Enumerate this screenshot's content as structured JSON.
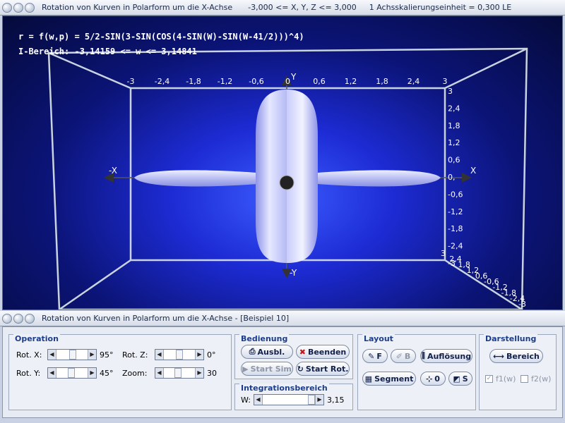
{
  "window": {
    "title": "Rotation von Kurven in Polarform um die X-Achse",
    "range": "-3,000 <= X, Y, Z <= 3,000",
    "scale": "1 Achsskalierungseinheit = 0,300 LE"
  },
  "scene": {
    "formula": "r = f(w,p) = 5/2-SIN(3-SIN(COS(4-SIN(W)-SIN(W-41/2)))^4)",
    "interval": "I-Bereich: -3,14159 <= w <= 3,14841",
    "x_ticks": [
      "-3",
      "-2,4",
      "-1,8",
      "-1,2",
      "-0,6",
      "0",
      "0,6",
      "1,2",
      "1,8",
      "2,4",
      "3"
    ],
    "y_ticks": [
      "3",
      "2,4",
      "1,8",
      "1,2",
      "0,6",
      "0,",
      "-0,6",
      "-1,2",
      "-1,8",
      "-2,4",
      "-3"
    ],
    "z_ticks": [
      "3",
      "2,4",
      "1,8",
      "1,2",
      "0,6",
      "-0,6",
      "-1,2",
      "-1,8",
      "-2,4",
      "-3"
    ],
    "axis_labels": {
      "x": "X",
      "neg_x": "-X",
      "y": "Y",
      "neg_y": "-Y"
    },
    "colors": {
      "bg_center": "#3b5cff",
      "bg_edge": "#050a3a",
      "surface": "#c9ccff"
    }
  },
  "panel": {
    "title": "Rotation von Kurven in Polarform um die X-Achse - [Beispiel 10]"
  },
  "operation": {
    "label": "Operation",
    "rot_x_label": "Rot. X:",
    "rot_x_value": "95°",
    "rot_y_label": "Rot. Y:",
    "rot_y_value": "45°",
    "rot_z_label": "Rot. Z:",
    "rot_z_value": "0°",
    "zoom_label": "Zoom:",
    "zoom_value": "30"
  },
  "bedienung": {
    "label": "Bedienung",
    "ausbl": "Ausbl.",
    "beenden": "Beenden",
    "start_sim": "Start Sim",
    "start_rot": "Start Rot."
  },
  "integration": {
    "label": "Integrationsbereich",
    "w_label": "W:",
    "w_value": "3,15"
  },
  "layout": {
    "label": "Layout",
    "f_btn": "F",
    "b_btn": "B",
    "aufloesung": "Auflösung",
    "segment": "Segment",
    "zero_btn": "0",
    "s_btn": "S"
  },
  "darstellung": {
    "label": "Darstellung",
    "bereich": "Bereich",
    "f1": "f1(w)",
    "f2": "f2(w)"
  }
}
